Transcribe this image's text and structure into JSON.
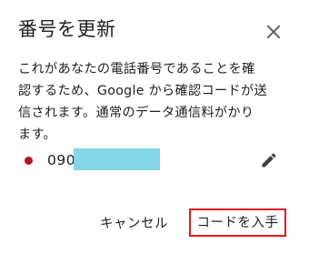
{
  "dialog": {
    "title": "番号を更新",
    "body_lines": [
      "これがあなたの電話番号であることを確",
      "認するため、Google から確認コードが送",
      "信されます。通常のデータ通信料がかり",
      "ます。"
    ],
    "phone": {
      "prefix": "090",
      "status_color": "#b3132b"
    },
    "actions": {
      "cancel_label": "キャンセル",
      "enter_code_label": "コードを入手"
    }
  },
  "icons": {
    "close": "close-icon",
    "edit": "pencil-icon"
  },
  "colors": {
    "highlight_border": "#e11920",
    "redaction": "#86d7e6"
  }
}
